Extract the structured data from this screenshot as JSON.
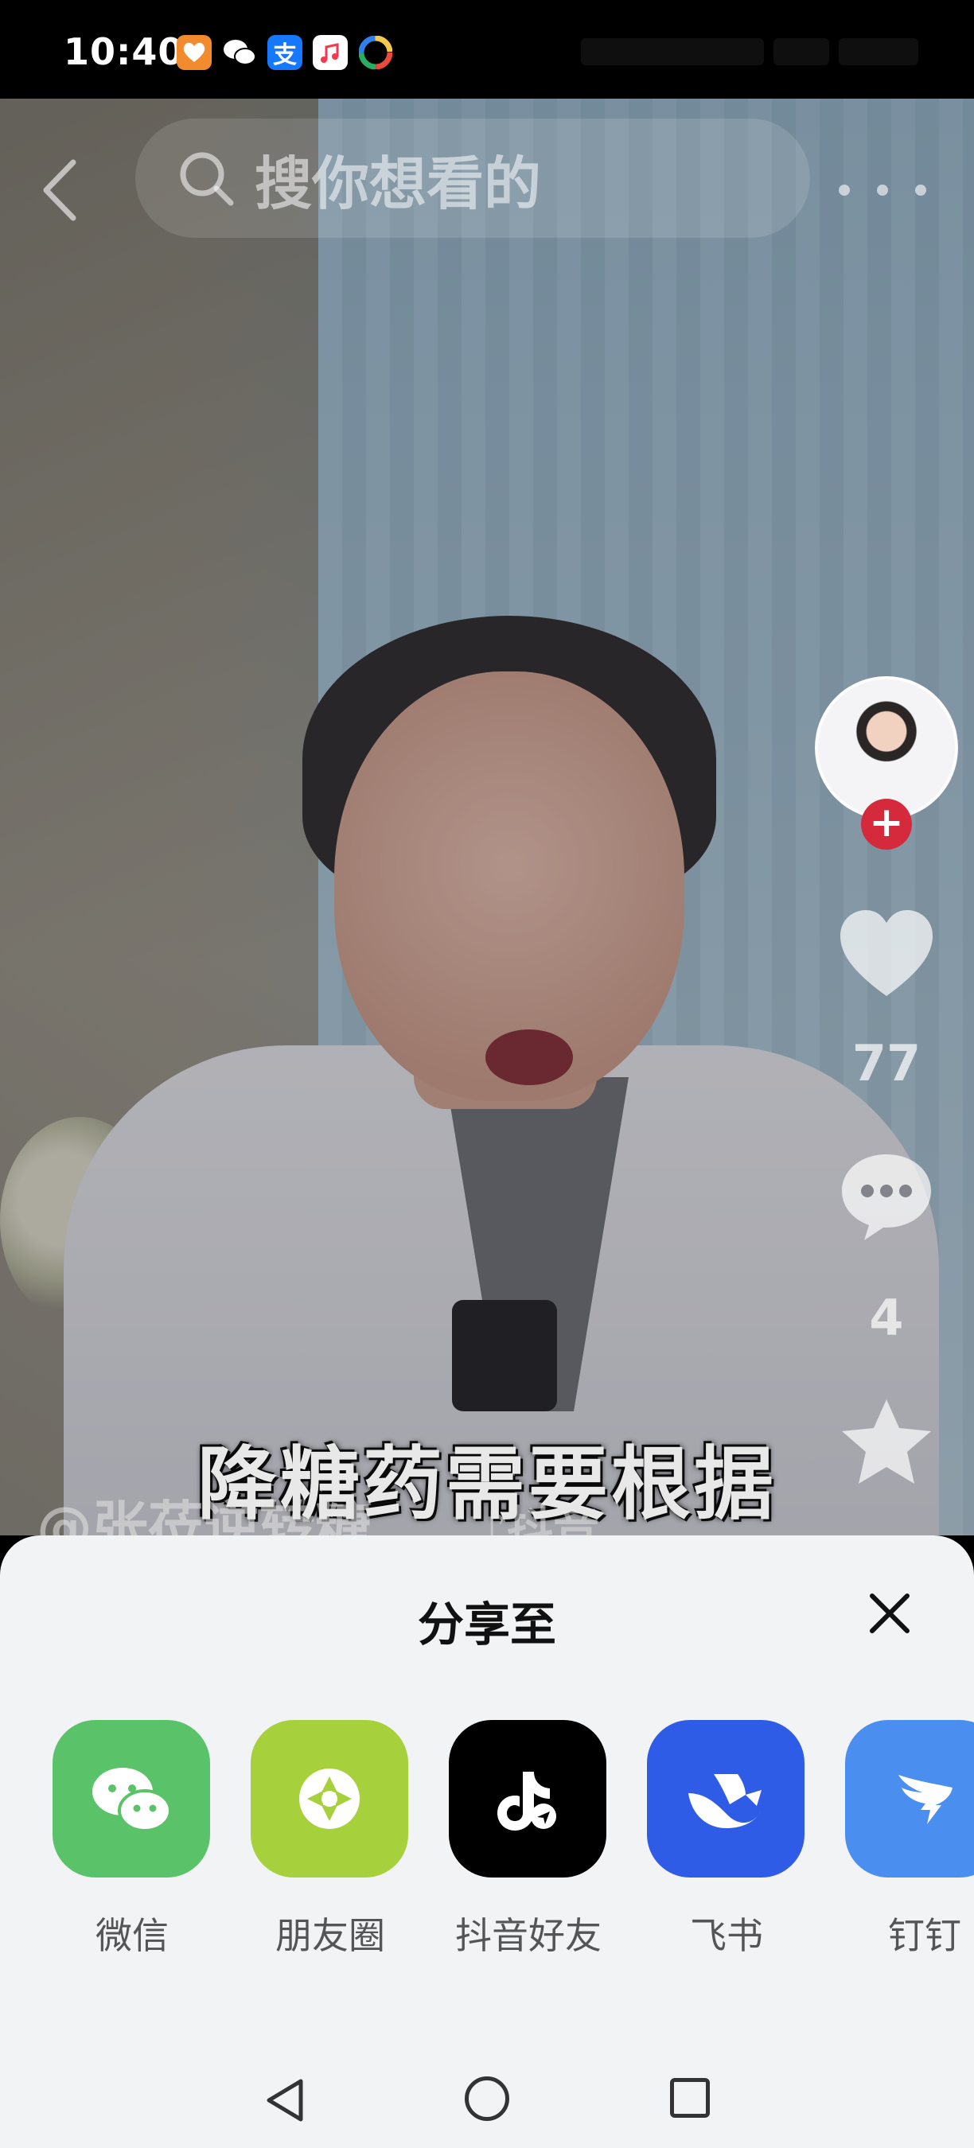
{
  "status_bar": {
    "time": "10:40",
    "app_icons": [
      "health-app-icon",
      "wechat-icon",
      "alipay-icon",
      "music-app-icon",
      "color-app-icon"
    ],
    "alipay_glyph": "支"
  },
  "top_nav": {
    "search_placeholder": "搜你想看的"
  },
  "video": {
    "caption": "降糖药需要根据",
    "watermark": "@张莅逆转糖",
    "platform_mark": "♪抖音"
  },
  "side_rail": {
    "follow_glyph": "+",
    "like_count": "77",
    "comment_count": "4"
  },
  "share_sheet": {
    "title": "分享至",
    "targets": [
      {
        "label": "微信",
        "icon": "wechat-icon",
        "color": "#5ac36a"
      },
      {
        "label": "朋友圈",
        "icon": "moments-icon",
        "color": "#a6d13c"
      },
      {
        "label": "抖音好友",
        "icon": "douyin-icon",
        "color": "#000000"
      },
      {
        "label": "飞书",
        "icon": "feishu-icon",
        "color": "#2f5ce6"
      },
      {
        "label": "钉钉",
        "icon": "dingtalk-icon",
        "color": "#4a8ff0"
      }
    ]
  },
  "colors": {
    "follow_red": "#d52a3b",
    "sheet_background": "#f2f3f5"
  }
}
